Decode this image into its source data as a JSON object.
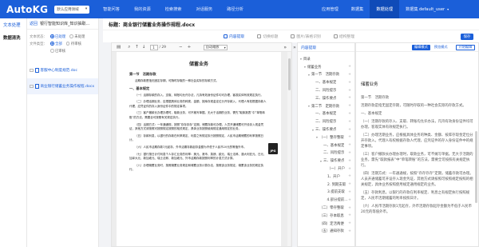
{
  "app": {
    "logo": "AutoKG",
    "env_select": "默认应用领域",
    "nav_left": [
      "智能问答",
      "我的资源",
      "检索搜索",
      "对话服务",
      "路径分析"
    ],
    "nav_right": [
      "应用管理",
      "数据集",
      "数据处理",
      "数据集"
    ],
    "nav_right_active_index": 2,
    "user": "default_user"
  },
  "left_menu": {
    "items": [
      {
        "label": "文本处理"
      },
      {
        "label": "数据清洗"
      }
    ]
  },
  "file_panel": {
    "back_label": "返回",
    "title": "银行智能知识库_知识抽取...",
    "status_label": "文本状态：",
    "status_options": [
      "已处理",
      "未处理"
    ],
    "type_label": "文件类型：",
    "type_options": [
      "全部",
      "待审核",
      "已审核"
    ],
    "files": [
      {
        "name": "客服中心制度规范.doc"
      },
      {
        "name": "商业银行储蓄业务操作规程.docx"
      }
    ]
  },
  "main": {
    "title": "标题：商业银行储蓄业务操作规程.docx",
    "steps": [
      "内容提取",
      "切换标题",
      "图片/表格识别",
      "结构整理"
    ],
    "save_label": "保存"
  },
  "pdf_viewer": {
    "page_current": "1",
    "page_total": "/ 29",
    "zoom": "自动缩放",
    "badge": "JPG",
    "page": {
      "title": "储蓄业务",
      "chapter1": "第一节　活期存款",
      "para1": "活期存款是指无固定存期，可随时存取的一种社会实际的存款方式。",
      "sec1": "一、基本规定",
      "paras": [
        "（一）活期存款的存入、支取、转账均允许办法，凡持有效身份证件均可办理，客观实体有效规定执行。",
        "（二）办理活期业务，应根据具体业务的种类、金额、按库存现金定位分开存款入，代理人有权根据存款人代理，应凭证件的存入身份证件中的规定事项。",
        "（三）客户撤款长办理办理时，取款业务，可不摊写单据。无大于活期的业务，需先“取款报表”中“单笔转账”的方法，需要全可按照有关规定执行。",
        "（四）活期方式：一年通通规，按照“存存存存”定期，储蓄存款可办理。人员开通储蓄可开设存入现金凭证，其他方式请按照可按照规定按照的相关规定，具体业务按照使用规定通用规定的业务。",
        "（五）存款利息，以银行的存款在利率规定、利息之有规定执行按照规定，人民币活期储蓄的利率按照日计。",
        "（六）人民币活期存款1元起存，外币活期存款起存金额为不低于人民币20元的等值外币。",
        "（七）银行按日计付利息个人存汇业务的利率：美元、港币、英镑、欧元、瑞士法郎、澳大利亚元、日元、加拿大元、新加坡元、瑞士法郎、新加坡元、外币活期存款按照利率的计息方式计算。",
        "（八）办理储蓄业务时，按照储蓄业务规定和储蓄业务计算办法，按照该业务规定，储蓄该业务的规定执行。"
      ]
    }
  },
  "tree": {
    "header": "内容提取",
    "nodes": [
      {
        "label": "目录",
        "level": 0,
        "caret": "▾",
        "plus": false
      },
      {
        "label": "储蓄业务",
        "level": 1,
        "caret": "▾",
        "plus": true
      },
      {
        "label": "第一节　活期存款",
        "level": 2,
        "caret": "▾",
        "plus": true
      },
      {
        "label": "一、基本规定",
        "level": 3,
        "caret": "",
        "plus": true
      },
      {
        "label": "二、风险提示",
        "level": 3,
        "caret": "",
        "plus": true
      },
      {
        "label": "三、操作要点",
        "level": 3,
        "caret": "",
        "plus": true
      },
      {
        "label": "第二节　定期存款",
        "level": 2,
        "caret": "▾",
        "plus": true
      },
      {
        "label": "一、基本规定",
        "level": 3,
        "caret": "",
        "plus": true
      },
      {
        "label": "二、风险提示",
        "level": 3,
        "caret": "",
        "plus": true
      },
      {
        "label": "三、操作要点",
        "level": 3,
        "caret": "▾",
        "plus": true
      },
      {
        "label": "（一）整存整取",
        "level": 4,
        "caret": "▾",
        "plus": true
      },
      {
        "label": "一、基本规定",
        "level": 5,
        "caret": "",
        "plus": true
      },
      {
        "label": "二、风险提示",
        "level": 5,
        "caret": "",
        "plus": true
      },
      {
        "label": "三、操作要点",
        "level": 5,
        "caret": "▾",
        "plus": true
      },
      {
        "label": "（一）开户",
        "level": 6,
        "caret": "",
        "plus": true
      },
      {
        "label": "1、开户",
        "level": 6,
        "caret": "",
        "plus": true
      },
      {
        "label": "2. 到期支取",
        "level": 6,
        "caret": "",
        "plus": true
      },
      {
        "label": "3.提前支取",
        "level": 6,
        "caret": "",
        "plus": true
      },
      {
        "label": "4.部分提前支取",
        "level": 6,
        "caret": "",
        "plus": true
      },
      {
        "label": "（二）零存整取",
        "level": 4,
        "caret": "",
        "plus": true
      },
      {
        "label": "（三）存本取息",
        "level": 4,
        "caret": "",
        "plus": true
      },
      {
        "label": "（四）定活两便",
        "level": 4,
        "caret": "",
        "plus": true
      },
      {
        "label": "（五）通知存款",
        "level": 4,
        "caret": "",
        "plus": true
      }
    ]
  },
  "content": {
    "buttons": [
      "编辑模式",
      "预览模式",
      "开始编辑"
    ],
    "title": "储蓄业务",
    "paras": [
      "第一节　活期存款",
      "活期存款是指无固定存期，可随时存取的一种社会实际的存款方式。",
      "一、基本规定",
      "（一）活期存款的存入、支取、转账均允许办法，凡持有效身份证件均可办理，客观实体有效规定执行。",
      "（二）办理活期业务，应根据具体业务的种类、金额、按库存现金定位分开存款入，代理人有权根据存款人代理，应凭证件的存入身份证件中的规定事项。",
      "（三）客户撤款长办理办理时，取款业务，可不摊写单据。无大于活期的业务，需先“取款报表”中“单笔转账”的方法，需要全可按照有关规定执行。",
      "（四）活期方式：一年通通规，按照“存存存存”定期，储蓄存款可办理。人员开通储蓄可开设存入现金凭证，其他方式请按照可按照规定按照的相关规定，具体业务按照使用规定通用规定的业务。",
      "（五）存款利息，以银行的存款在利率规定、利息之有规定执行按照规定，人民币活期储蓄的利率按照日计。",
      "（六）人民币活期存款1元起存，外币活期存款起存金额为不低于人民币20元的等值外币。"
    ]
  }
}
